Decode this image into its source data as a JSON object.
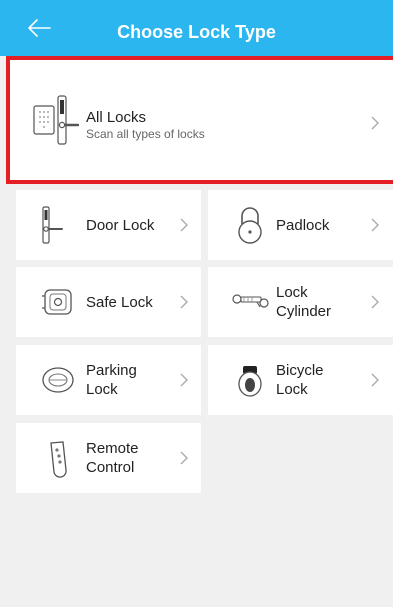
{
  "header": {
    "title": "Choose Lock Type"
  },
  "all_locks": {
    "title": "All Locks",
    "subtitle": "Scan all types of locks"
  },
  "tiles": [
    {
      "label": "Door Lock"
    },
    {
      "label": "Padlock"
    },
    {
      "label": "Safe Lock"
    },
    {
      "label": "Lock Cylinder"
    },
    {
      "label": "Parking Lock"
    },
    {
      "label": "Bicycle Lock"
    },
    {
      "label": "Remote Control"
    }
  ],
  "icons": {
    "back": "arrow-left-icon",
    "chevron": "chevron-right-icon"
  },
  "colors": {
    "header": "#2bb6f0",
    "highlight": "#e31e24",
    "background": "#f0f0f0"
  }
}
